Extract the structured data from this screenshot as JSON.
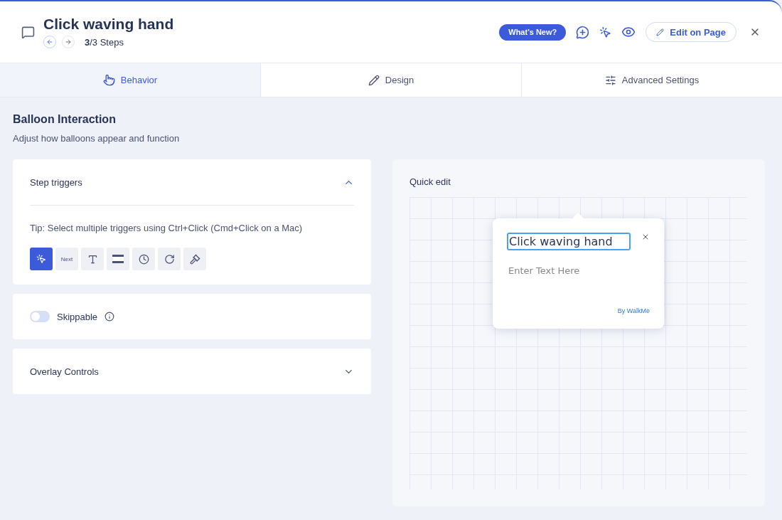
{
  "header": {
    "title": "Click waving hand",
    "step_counter": "**3**/3 Steps",
    "whats_new": "What's New?",
    "edit_button": "Edit on Page"
  },
  "tabs": [
    {
      "label": "Behavior",
      "kind": "hand",
      "selected": true
    },
    {
      "label": "Design",
      "kind": "pencil",
      "selected": false
    },
    {
      "label": "Advanced Settings",
      "kind": "sliders",
      "selected": false
    }
  ],
  "section": {
    "title": "Balloon Interaction",
    "subtitle": "Adjust how balloons appear and function"
  },
  "step_triggers": {
    "title": "Step triggers",
    "expanded": true,
    "tip": "Tip: Select multiple triggers using Ctrl+Click (Cmd+Click on a Mac)",
    "triggers": [
      {
        "kind": "click",
        "selected": true
      },
      {
        "kind": "next",
        "label": "Next",
        "selected": false
      },
      {
        "kind": "text",
        "selected": false
      },
      {
        "kind": "bar",
        "selected": false
      },
      {
        "kind": "timer",
        "selected": false
      },
      {
        "kind": "redo",
        "selected": false
      },
      {
        "kind": "hammer",
        "selected": false
      }
    ]
  },
  "skippable": {
    "label": "Skippable",
    "on": false
  },
  "overlay_controls": {
    "title": "Overlay Controls",
    "expanded": false
  },
  "quick_edit": {
    "title": "Quick edit",
    "balloon": {
      "title": "Click waving hand",
      "placeholder": "Enter Text Here",
      "brand": "By WalkMe"
    }
  }
}
